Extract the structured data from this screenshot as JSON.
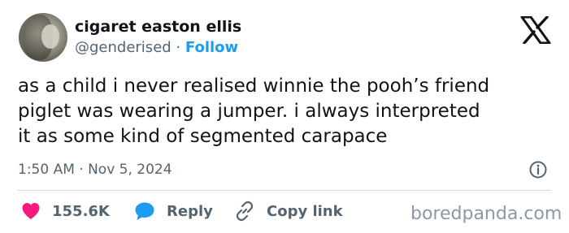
{
  "author": {
    "display_name": "cigaret easton ellis",
    "handle": "@genderised",
    "separator": "·",
    "follow_label": "Follow"
  },
  "tweet": {
    "lines": [
      "as a child i never realised winnie the pooh’s friend",
      "piglet was wearing a jumper. i always interpreted",
      "it as some kind of segmented carapace"
    ],
    "timestamp": "1:50 AM · Nov 5, 2024"
  },
  "actions": {
    "like_count": "155.6K",
    "reply_label": "Reply",
    "copy_link_label": "Copy link"
  },
  "watermark": "boredpanda.com",
  "icons": {
    "x_logo": "x-logo-icon",
    "info": "info-icon",
    "heart": "heart-icon",
    "reply": "speech-bubble-icon",
    "link": "link-icon"
  },
  "colors": {
    "text": "#0f1419",
    "secondary": "#536471",
    "accent": "#1d9bf0",
    "like": "#f91880",
    "divider": "#cfd9de"
  }
}
